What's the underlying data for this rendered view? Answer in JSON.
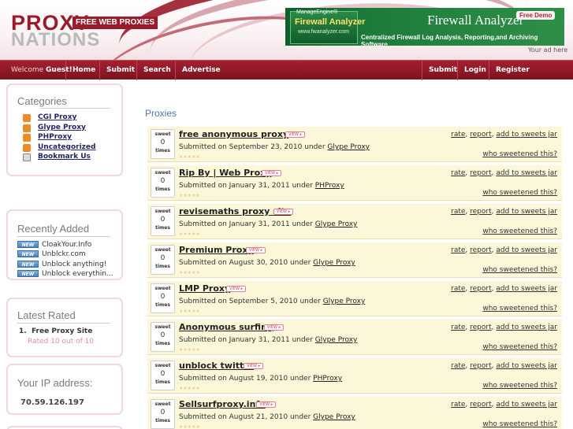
{
  "logo": {
    "proxy": "PROXY",
    "tagline": "FREE WEB PROXIES",
    "nations": "NATIONS"
  },
  "ad": {
    "brand": "ManageEngine®",
    "product": "Firewall Analyzer",
    "url": "www.fwanalyzer.com",
    "title": "Firewall Analyzer",
    "demo": "Free Demo",
    "subtitle": "Centralized Firewall Log Analysis, Reporting,and Archiving Software",
    "ad_link": "Your ad here"
  },
  "nav": {
    "welcome_prefix": "Welcome ",
    "welcome_user": "Guest!",
    "left": [
      "Home",
      "Submit",
      "Search",
      "Advertise"
    ],
    "right": [
      "Submit",
      "Login",
      "Register"
    ]
  },
  "sidebar": {
    "categories": {
      "title": "Categories",
      "items": [
        {
          "label": "CGI Proxy",
          "icon": "rss-icon"
        },
        {
          "label": "Glype Proxy",
          "icon": "rss-icon"
        },
        {
          "label": "PHProxy",
          "icon": "rss-icon"
        },
        {
          "label": "Uncategorized",
          "icon": "rss-icon"
        },
        {
          "label": "Bookmark Us",
          "icon": "bookmark-icon"
        }
      ]
    },
    "recent": {
      "title": "Recently Added",
      "badge": "NEW",
      "items": [
        "CloakYour.Info",
        "Unblckr.com",
        "Unblock anything!",
        "Unblock everythin..."
      ]
    },
    "rated": {
      "title": "Latest Rated",
      "item_num": "1.",
      "item": "Free Proxy Site",
      "sub": "Rated 10 out of 10"
    },
    "ip": {
      "title": "Your IP address:",
      "value": "70.59.126.197"
    }
  },
  "main": {
    "title": "Proxies",
    "vote_top": "sweet",
    "vote_bottom": "times",
    "view_badge": "VIEW ▸",
    "submitted_prefix": "Submitted on ",
    "under": " under ",
    "actions": {
      "rate": "rate",
      "report": "report",
      "sweets": "add to sweets jar"
    },
    "who": "who sweetened this?",
    "proxies": [
      {
        "title": "free anonymous proxy",
        "count": "0",
        "date": "September 23, 2010",
        "category": "Glype Proxy"
      },
      {
        "title": "Rip By | Web Proxy",
        "count": "0",
        "date": "January 31, 2011",
        "category": "PHProxy"
      },
      {
        "title": "revisemaths proxy site",
        "count": "0",
        "date": "January 31, 2011",
        "category": "Glype Proxy"
      },
      {
        "title": "Premium Proxy",
        "count": "0",
        "date": "August 30, 2010",
        "category": "Glype Proxy"
      },
      {
        "title": "LMP Proxy",
        "count": "0",
        "date": "September 5, 2010",
        "category": "Glype Proxy"
      },
      {
        "title": "Anonymous surfing",
        "count": "0",
        "date": "January 31, 2011",
        "category": "Glype Proxy"
      },
      {
        "title": "unblock twitter",
        "count": "0",
        "date": "August 19, 2010",
        "category": "PHProxy"
      },
      {
        "title": "Sellsurfproxy.info",
        "count": "0",
        "date": "August 21, 2010",
        "category": "Glype Proxy"
      }
    ]
  }
}
